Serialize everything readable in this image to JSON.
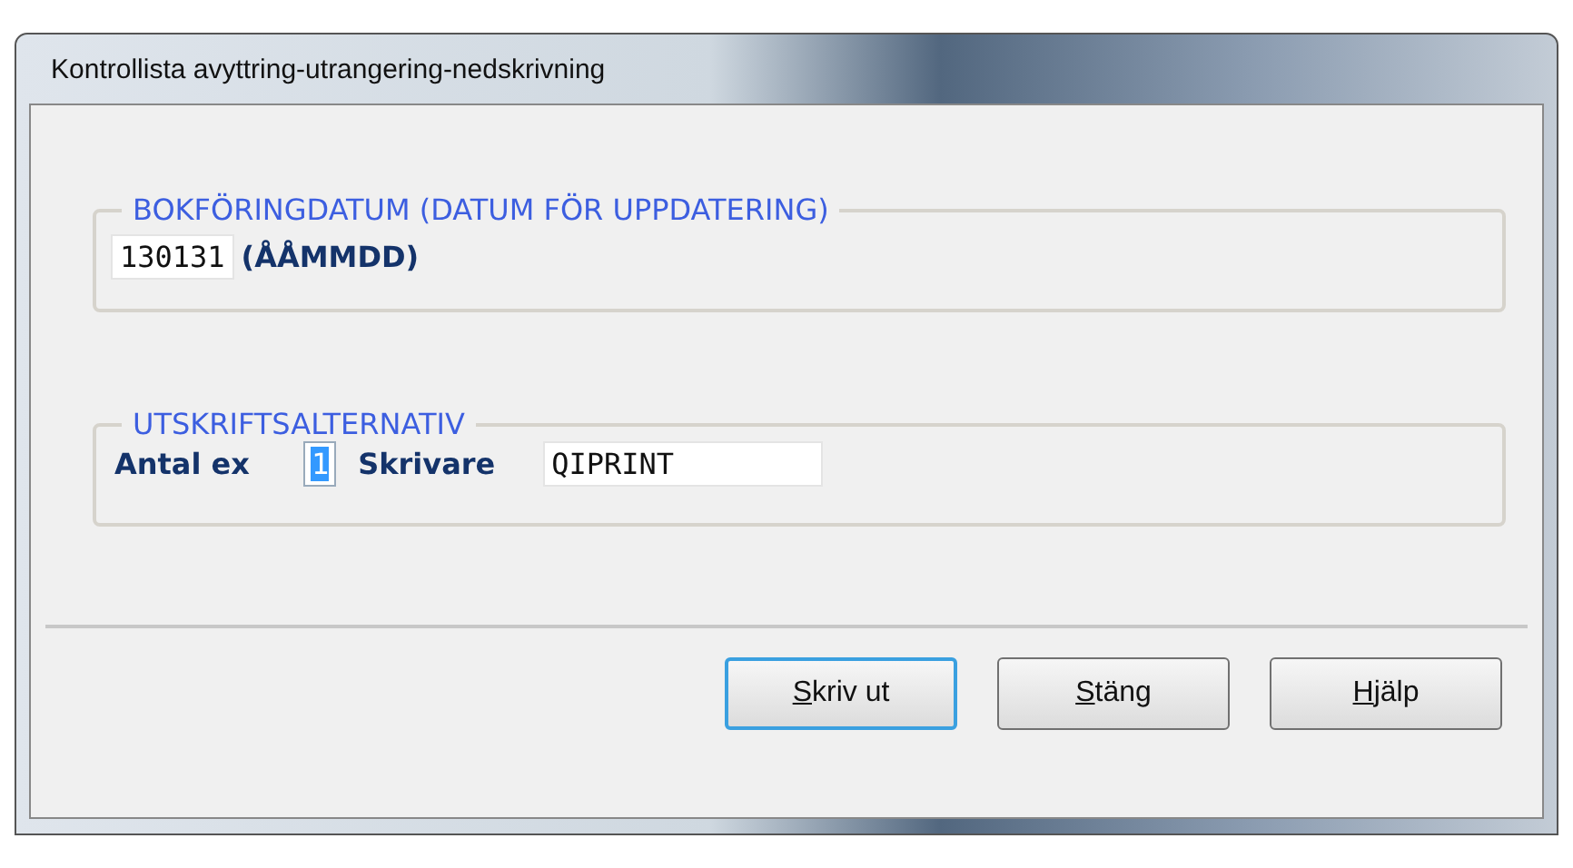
{
  "window": {
    "title": "Kontrollista avyttring-utrangering-nedskrivning"
  },
  "posting_date": {
    "legend": "BOKFÖRINGDATUM (DATUM FÖR UPPDATERING)",
    "value": "130131",
    "format_hint": "(ÅÅMMDD)"
  },
  "print_options": {
    "legend": "UTSKRIFTSALTERNATIV",
    "copies_label": "Antal ex",
    "copies_value": "1",
    "copies_selected": true,
    "printer_label": "Skrivare",
    "printer_value": "QIPRINT"
  },
  "buttons": [
    {
      "label": "Skriv ut",
      "focused": true
    },
    {
      "label": "Stäng",
      "focused": false
    },
    {
      "label": "Hjälp",
      "focused": false
    }
  ]
}
